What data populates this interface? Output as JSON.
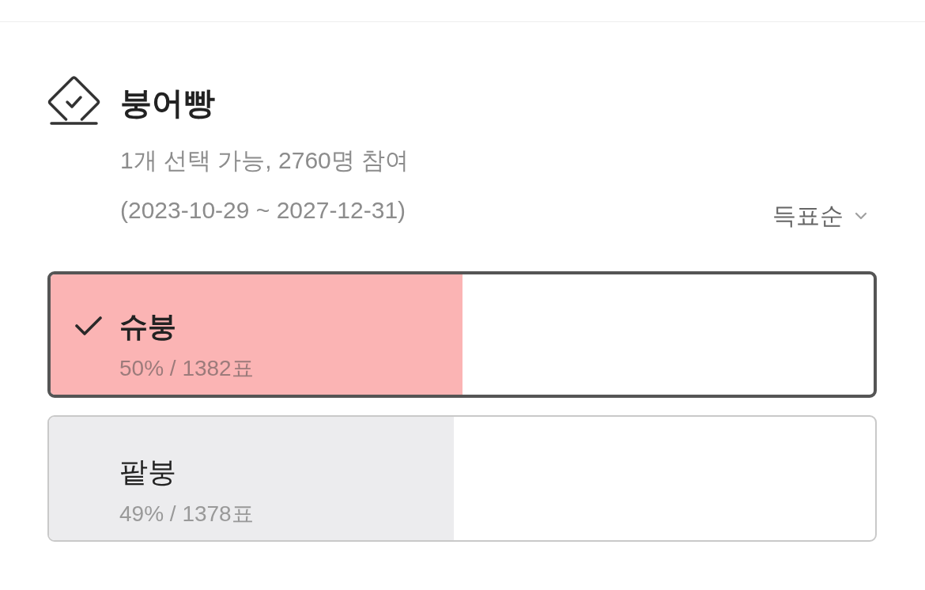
{
  "poll": {
    "title": "붕어빵",
    "info": "1개 선택 가능, 2760명 참여",
    "period": "(2023-10-29 ~ 2027-12-31)"
  },
  "sort": {
    "label": "득표순"
  },
  "options": [
    {
      "label": "슈붕",
      "stats": "50% / 1382표",
      "level": 0.5,
      "selected": true
    },
    {
      "label": "팥붕",
      "stats": "49% / 1378표",
      "level": 0.49,
      "selected": false
    }
  ]
}
